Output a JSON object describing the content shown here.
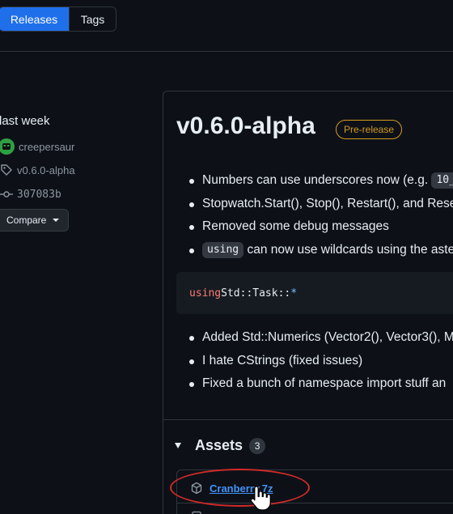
{
  "tabs": [
    {
      "label": "Releases",
      "active": true
    },
    {
      "label": "Tags",
      "active": false
    }
  ],
  "meta": {
    "when": "last week",
    "author": "creepersaur",
    "tag": "v0.6.0-alpha",
    "commit": "307083b",
    "compare_label": "Compare"
  },
  "release": {
    "title": "v0.6.0-alpha",
    "badge": "Pre-release",
    "notes_top": [
      {
        "text": "Numbers can use underscores now (e.g. ",
        "code": "10_"
      },
      {
        "text": "Stopwatch.Start(), Stop(), Restart(), and Reset"
      },
      {
        "text": "Removed some debug messages"
      },
      {
        "code": "using",
        "text": " can now use wildcards using the aste"
      }
    ],
    "code_block": {
      "keyword": "using",
      "path": " Std::Task::",
      "wildcard": "*"
    },
    "notes_bottom": [
      "Added Std::Numerics (Vector2(), Vector3(), M",
      "I hate CStrings (fixed issues)",
      "Fixed a bunch of namespace import stuff an"
    ]
  },
  "assets": {
    "title": "Assets",
    "count": "3",
    "items": [
      {
        "name": "Cranberry.7z",
        "icon": "package-icon"
      }
    ]
  },
  "colors": {
    "accent": "#1f6feb",
    "link": "#4493f8",
    "prerelease": "#d29922",
    "annotation": "#d12a2a"
  }
}
